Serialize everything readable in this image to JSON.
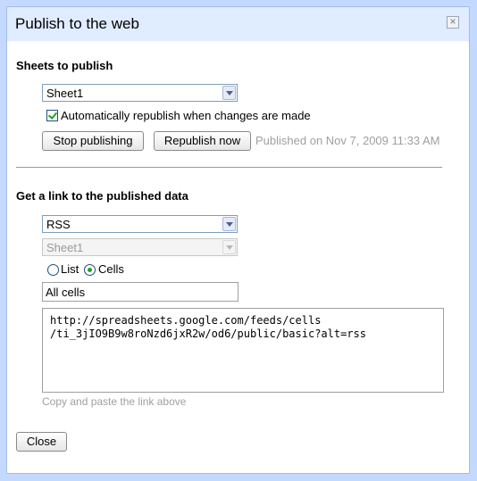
{
  "dialog": {
    "title": "Publish to the web",
    "close_icon": "close-icon"
  },
  "sheets": {
    "heading": "Sheets to publish",
    "selected_sheet": "Sheet1",
    "auto_republish_label": "Automatically republish when changes are made",
    "auto_republish_checked": true,
    "stop_button": "Stop publishing",
    "republish_button": "Republish now",
    "status": "Published on Nov 7, 2009 11:33 AM"
  },
  "link": {
    "heading": "Get a link to the published data",
    "format": "RSS",
    "sheet": "Sheet1",
    "view_list_label": "List",
    "view_cells_label": "Cells",
    "selected_view": "Cells",
    "range": "All cells",
    "url": "http://spreadsheets.google.com/feeds/cells\n/ti_3jIO9B9w8roNzd6jxR2w/od6/public/basic?alt=rss",
    "hint": "Copy and paste the link above"
  },
  "footer": {
    "close_button": "Close"
  }
}
